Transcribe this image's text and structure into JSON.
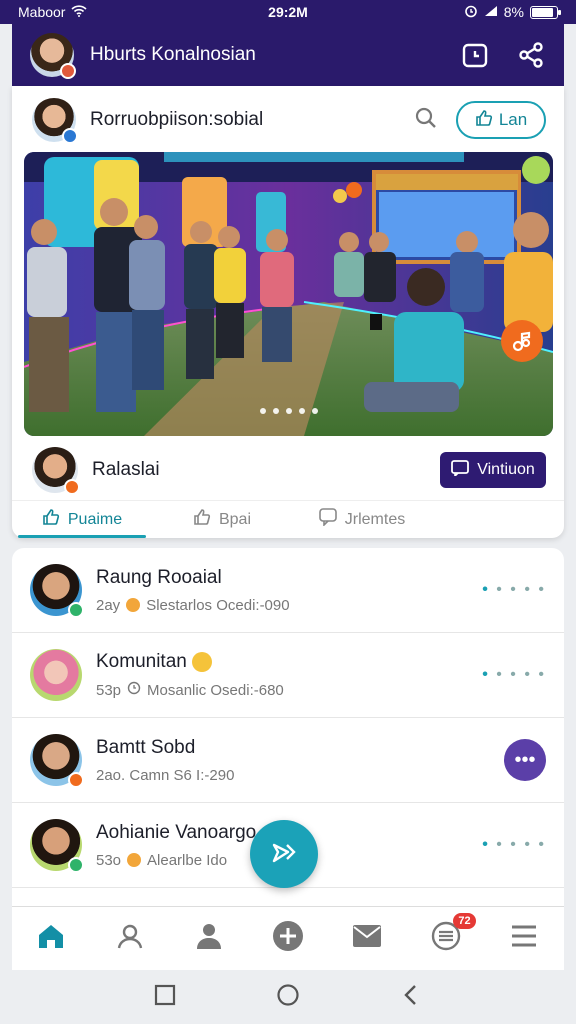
{
  "status": {
    "carrier": "Maboor",
    "time": "29:2M",
    "battery": "8%",
    "battery_level": 0.8
  },
  "appbar": {
    "title": "Hburts Konalnosian",
    "avatar": "user-avatar"
  },
  "post": {
    "group_name": "Rorruobpiison:sobial",
    "join_label": "Lan",
    "author_name": "Ralaslai",
    "follow_label": "Vintiuon",
    "slides": 5,
    "tabs": [
      {
        "label": "Puaime",
        "icon": "thumb-up-icon"
      },
      {
        "label": "Bpai",
        "icon": "share-icon"
      },
      {
        "label": "Jrlemtes",
        "icon": "comment-icon"
      }
    ]
  },
  "list": [
    {
      "title": "Raung Rooaial",
      "meta1": "2ay",
      "meta2": "Slestarlos Ocedi:-090"
    },
    {
      "title": "Komunitan",
      "meta1": "53p",
      "meta2": "Mosanlic Osedi:-680"
    },
    {
      "title": "Bamtt Sobd",
      "meta1": "2ao. Camn S6 I:-290",
      "meta2": ""
    },
    {
      "title": "Aohianie Vanoargo",
      "meta1": "53o",
      "meta2": "Alearlbe Ido"
    }
  ],
  "nav": {
    "badge": "72"
  },
  "colors": {
    "brand": "#2a1a6b",
    "accent": "#1aa0b3",
    "orange": "#f06b1e"
  }
}
